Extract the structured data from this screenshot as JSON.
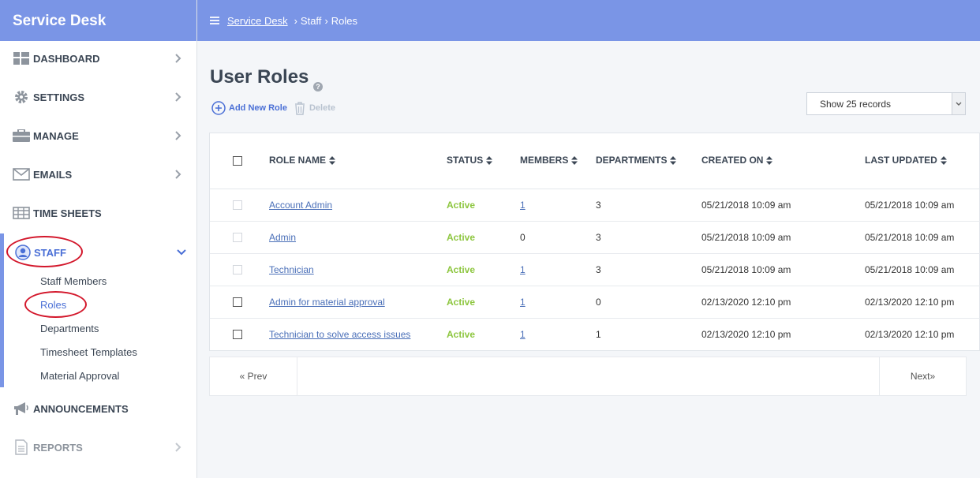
{
  "app": {
    "title": "Service Desk"
  },
  "breadcrumb": {
    "home": "Service Desk",
    "sep1": "›",
    "staff": "Staff",
    "sep2": "›",
    "current": "Roles"
  },
  "sidebar": {
    "items": [
      {
        "label": "DASHBOARD"
      },
      {
        "label": "SETTINGS"
      },
      {
        "label": "MANAGE"
      },
      {
        "label": "EMAILS"
      },
      {
        "label": "TIME SHEETS"
      },
      {
        "label": "STAFF"
      },
      {
        "label": "ANNOUNCEMENTS"
      },
      {
        "label": "REPORTS"
      }
    ],
    "staff_sub": [
      "Staff Members",
      "Roles",
      "Departments",
      "Timesheet Templates",
      "Material Approval"
    ]
  },
  "page": {
    "title": "User Roles",
    "add_label": "Add New Role",
    "delete_label": "Delete",
    "records_label": "Show 25 records"
  },
  "table": {
    "headers": [
      "ROLE NAME",
      "STATUS",
      "MEMBERS",
      "DEPARTMENTS",
      "CREATED ON",
      "LAST UPDATED"
    ],
    "rows": [
      {
        "name": "Account Admin",
        "status": "Active",
        "members": "1",
        "departments": "3",
        "created": "05/21/2018 10:09 am",
        "updated": "05/21/2018 10:09 am"
      },
      {
        "name": "Admin",
        "status": "Active",
        "members": "0",
        "departments": "3",
        "created": "05/21/2018 10:09 am",
        "updated": "05/21/2018 10:09 am"
      },
      {
        "name": "Technician",
        "status": "Active",
        "members": "1",
        "departments": "3",
        "created": "05/21/2018 10:09 am",
        "updated": "05/21/2018 10:09 am"
      },
      {
        "name": "Admin for material approval",
        "status": "Active",
        "members": "1",
        "departments": "0",
        "created": "02/13/2020 12:10 pm",
        "updated": "02/13/2020 12:10 pm"
      },
      {
        "name": "Technician to solve access issues",
        "status": "Active",
        "members": "1",
        "departments": "1",
        "created": "02/13/2020 12:10 pm",
        "updated": "02/13/2020 12:10 pm"
      }
    ]
  },
  "pager": {
    "prev": "« Prev",
    "next": "Next»"
  },
  "colors": {
    "accent": "#7a95e6",
    "link": "#4a6fb8",
    "active_status": "#8dc63f",
    "highlight_ring": "#d3172b"
  },
  "icons": {
    "dashboard": "grid-icon",
    "settings": "gear-icon",
    "manage": "briefcase-icon",
    "emails": "envelope-icon",
    "timesheets": "table-icon",
    "staff": "user-circle-icon",
    "announcements": "megaphone-icon",
    "reports": "document-icon"
  }
}
